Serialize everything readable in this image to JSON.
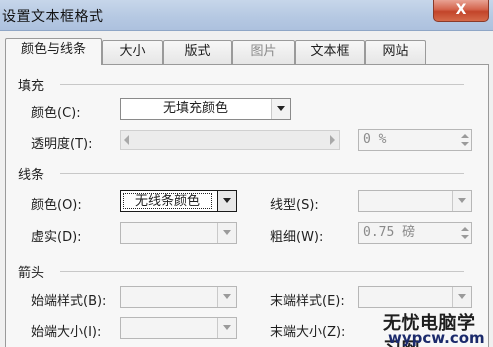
{
  "window": {
    "title": "设置文本框格式",
    "close_label": "X"
  },
  "tabs": [
    {
      "label": "颜色与线条",
      "active": true
    },
    {
      "label": "大小"
    },
    {
      "label": "版式"
    },
    {
      "label": "图片",
      "disabled": true
    },
    {
      "label": "文本框"
    },
    {
      "label": "网站"
    }
  ],
  "fill": {
    "section_label": "填充",
    "color_label": "颜色(C):",
    "color_value": "无填充颜色",
    "transparency_label": "透明度(T):",
    "transparency_value": "0 %"
  },
  "line": {
    "section_label": "线条",
    "color_label": "颜色(O):",
    "color_value": "无线条颜色",
    "style_label": "线型(S):",
    "dash_label": "虚实(D):",
    "weight_label": "粗细(W):",
    "weight_value": "0.75 磅"
  },
  "arrows": {
    "section_label": "箭头",
    "begin_style_label": "始端样式(B):",
    "end_style_label": "末端样式(E):",
    "begin_size_label": "始端大小(I):",
    "end_size_label": "末端大小(Z):"
  },
  "watermark": {
    "line1": "无忧电脑学习网",
    "line2": "wypcw.com"
  }
}
